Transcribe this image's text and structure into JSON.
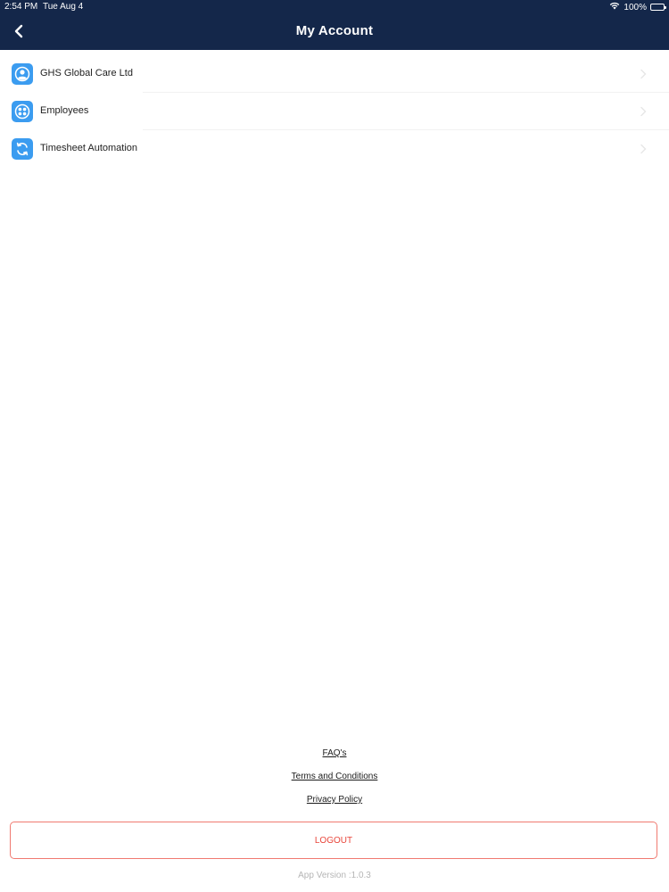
{
  "status_bar": {
    "time": "2:54 PM",
    "date": "Tue Aug 4",
    "battery": "100%",
    "wifi_icon": "wifi-icon",
    "battery_icon": "battery-icon"
  },
  "header": {
    "title": "My Account",
    "back_icon": "chevron-left-icon",
    "background": "#14274a"
  },
  "menu": {
    "items": [
      {
        "label": "GHS Global Care Ltd",
        "icon": "user-icon"
      },
      {
        "label": "Employees",
        "icon": "employees-icon"
      },
      {
        "label": "Timesheet Automation",
        "icon": "sync-icon"
      }
    ],
    "icon_color": "#3b9cf0"
  },
  "footer": {
    "faq": "FAQ's",
    "terms": "Terms and Conditions",
    "privacy": "Privacy Policy",
    "logout": "LOGOUT",
    "version": "App Version :1.0.3",
    "logout_color": "#e8453a"
  }
}
